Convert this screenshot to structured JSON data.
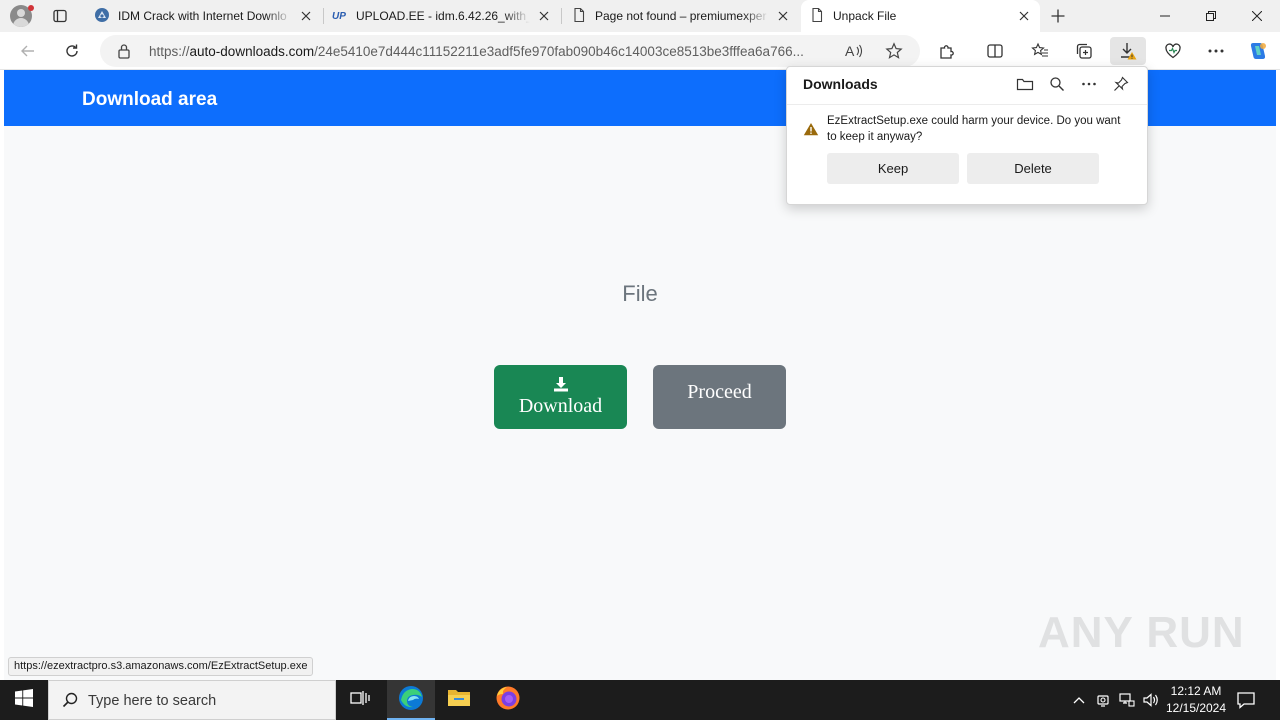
{
  "browser": {
    "tabs": [
      {
        "title": "IDM Crack with Internet Downlo",
        "favicon": "idm-favicon",
        "active": false
      },
      {
        "title": "UPLOAD.EE - idm.6.42.26_with_a",
        "favicon": "upload-ee-favicon",
        "active": false
      },
      {
        "title": "Page not found – premiumexper",
        "favicon": "page-icon",
        "active": false
      },
      {
        "title": "Unpack File",
        "favicon": "page-icon",
        "active": true
      }
    ],
    "url": {
      "scheme": "https://",
      "host": "auto-downloads.com",
      "path": "/24e5410e7d444c11152211e3adf5fe970fab090b46c14003ce8513be3fffea6a766..."
    }
  },
  "page": {
    "header_brand": "Download area",
    "file_label": "File",
    "download_button": "Download",
    "proceed_button": "Proceed",
    "status_url": "https://ezextractpro.s3.amazonaws.com/EzExtractSetup.exe",
    "watermark": "ANY RUN"
  },
  "downloads_panel": {
    "title": "Downloads",
    "warning": "EzExtractSetup.exe could harm your device. Do you want to keep it anyway?",
    "keep_label": "Keep",
    "delete_label": "Delete"
  },
  "taskbar": {
    "search_placeholder": "Type here to search",
    "time": "12:12 AM",
    "date": "12/15/2024"
  },
  "colors": {
    "header_blue": "#0d6efd",
    "download_green": "#198754",
    "proceed_gray": "#6c757d",
    "warning_amber": "#c58a0c"
  }
}
